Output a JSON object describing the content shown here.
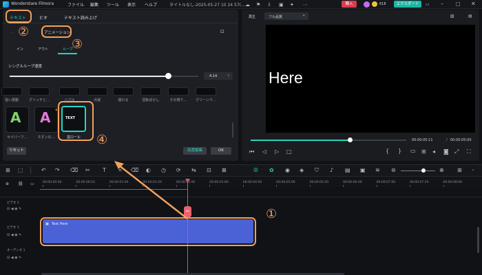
{
  "app": {
    "title": "Wonderstare Filmora",
    "menu": [
      "ファイル",
      "編集",
      "ツール",
      "表示",
      "ヘルプ"
    ],
    "doc_title": "タイトルなし-2025-05-27 10 24 57(…",
    "buy_label": "購入",
    "credits": "618",
    "export_label": "エクスポート"
  },
  "left_panel": {
    "tabs": [
      "テキスト",
      "ビオ",
      "テキスト読み上げ"
    ],
    "sub_tabs": [
      "アニメーション"
    ],
    "anim_tabs": [
      "イン",
      "アウト",
      "ループ"
    ],
    "section_label": "シングルループ速度",
    "slider_value": "4.14",
    "slider_fraction": 0.84,
    "presets_row1": [
      "強い振動",
      "グリッチと…",
      "バブル",
      "点滅",
      "揺れる",
      "回転ぼかし",
      "その場で…",
      "グリーンウ…"
    ],
    "presets_row2": [
      {
        "label": "セイバーフ…",
        "glyph": "A",
        "color": "#7fd36b"
      },
      {
        "label": "ネオンの…",
        "glyph": "A",
        "color": "#e07ad8"
      },
      {
        "label": "並ロール",
        "glyph": "TEXT",
        "color": "#ffffff"
      }
    ],
    "reset_label": "リセット",
    "advanced_label": "高度編集",
    "ok_label": "OK"
  },
  "preview": {
    "tabs": [
      "再生",
      "フル品質"
    ],
    "canvas_text": "Here",
    "progress_fraction": 0.64,
    "current_time": "00:00:05:11",
    "separator": "/",
    "total_time": "00:00:05:00"
  },
  "timeline": {
    "ruler_labels": [
      "00:00:00:00",
      "00:00:00:10",
      "00:00:01:00",
      "00:00:01:20",
      "00:00:02:00",
      "00:00:03:00",
      "00:00:04:00",
      "00:00:05:00",
      "00:00:05:20",
      "00:00:06:00",
      "00:00:07:00",
      "00:00:07:20",
      "00:00:08:00",
      "00:00:09:00"
    ],
    "tracks": [
      "ビデオ 2",
      "ビデオ 1",
      "オーディオ 1"
    ],
    "clip_label": "Text Here"
  },
  "annotations": [
    "①",
    "②",
    "③",
    "④"
  ],
  "annotation_color": "#f5a05a",
  "accent_color": "#2ad4c0",
  "clip_color": "#4a62d6"
}
